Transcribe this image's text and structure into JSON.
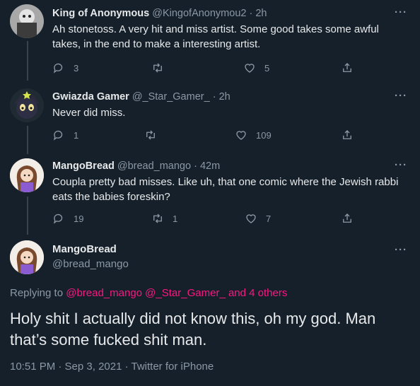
{
  "tweets": [
    {
      "name": "King of Anonymous",
      "handle": "@KingofAnonymou2",
      "time": "2h",
      "text": "Ah stonetoss. A very hit and miss artist. Some good takes some awful takes, in the end to make a interesting artist.",
      "replies": "3",
      "retweets": "",
      "likes": "5"
    },
    {
      "name": "Gwiazda Gamer",
      "handle": "@_Star_Gamer_",
      "time": "2h",
      "text": "Never did miss.",
      "replies": "1",
      "retweets": "",
      "likes": "109"
    },
    {
      "name": "MangoBread",
      "handle": "@bread_mango",
      "time": "42m",
      "text": "Coupla pretty bad misses. Like uh, that one comic where the Jewish rabbi eats the babies foreskin?",
      "replies": "19",
      "retweets": "1",
      "likes": "7"
    }
  ],
  "main": {
    "name": "MangoBread",
    "handle": "@bread_mango",
    "replying_prefix": "Replying to",
    "replying_links": "@bread_mango @_Star_Gamer_ and 4 others",
    "text": "Holy shit I actually did not know this, oh my god. Man that’s some fucked shit man.",
    "meta": "10:51 PM · Sep 3, 2021 · Twitter for iPhone"
  },
  "ui": {
    "more": "···",
    "dot": "·"
  },
  "colors": {
    "background": "#15202b",
    "text": "#e7e9ea",
    "muted": "#8b98a5",
    "link": "#f91880",
    "line": "#38444d"
  },
  "icons": {
    "reply": "reply-icon",
    "retweet": "retweet-icon",
    "like": "like-icon",
    "share": "share-icon",
    "more": "more-icon"
  }
}
